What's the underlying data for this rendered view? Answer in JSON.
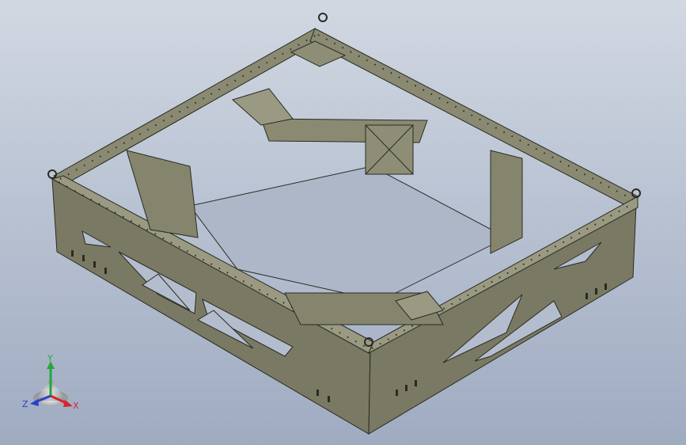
{
  "view": {
    "background_top": "#d2d8e2",
    "background_bottom": "#9fabc1",
    "model_color": "#7a7a64",
    "model_edge_color": "#2a2a22",
    "model_highlight": "#9a9a82"
  },
  "triad": {
    "x_label": "X",
    "y_label": "Y",
    "z_label": "Z",
    "x_color": "#d4262a",
    "y_color": "#22a83a",
    "z_color": "#2a3fc8"
  }
}
